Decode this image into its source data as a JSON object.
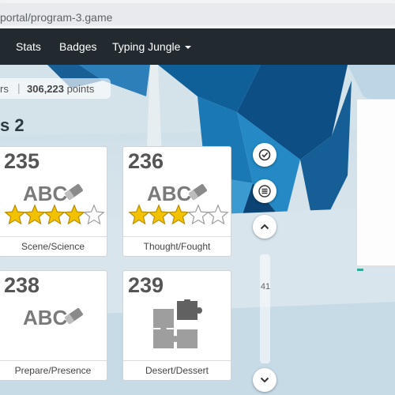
{
  "browser": {
    "url": "portal/program-3.game"
  },
  "nav": {
    "items": [
      {
        "label": "Stats"
      },
      {
        "label": "Badges"
      },
      {
        "label": "Typing Jungle"
      }
    ]
  },
  "stats": {
    "prefix": "rs",
    "points_value": "306,223",
    "points_unit": "points"
  },
  "section": {
    "title": "s 2"
  },
  "cards": [
    {
      "number": "235",
      "label": "Scene/Science",
      "stars": 4,
      "icon": "abc-eraser-icon"
    },
    {
      "number": "236",
      "label": "Thought/Fought",
      "stars": 3,
      "icon": "abc-eraser-icon"
    },
    {
      "number": "238",
      "label": "Prepare/Presence",
      "stars": 0,
      "icon": "abc-eraser-icon"
    },
    {
      "number": "239",
      "label": "Desert/Dessert",
      "stars": 0,
      "icon": "puzzle-icon"
    }
  ],
  "sidebar_controls": {
    "buttons": [
      "check-circle-icon",
      "menu-icon",
      "chevron-up-icon",
      "chevron-down-icon"
    ],
    "scroll_position_label": "41"
  },
  "colors": {
    "navbar": "#222a30",
    "star": "#f2c200",
    "accent_blue": "#1a78b4"
  }
}
